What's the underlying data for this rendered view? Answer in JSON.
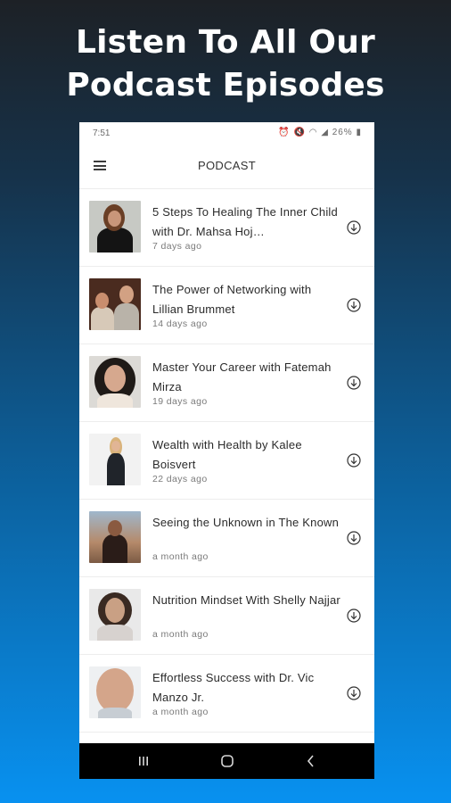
{
  "promo": {
    "line1": "Listen To All Our",
    "line2": "Podcast Episodes"
  },
  "status_bar": {
    "time": "7:51",
    "battery": "26%"
  },
  "app_bar": {
    "title": "PODCAST",
    "menu_icon": "hamburger-menu-icon"
  },
  "episodes": [
    {
      "title": "5 Steps To Healing The Inner Child with Dr. Mahsa Hoj…",
      "date": "7 days ago"
    },
    {
      "title": "The Power of Networking with Lillian Brummet",
      "date": "14 days ago"
    },
    {
      "title": "Master Your Career with Fatemah Mirza",
      "date": "19 days ago"
    },
    {
      "title": "Wealth with Health by Kalee Boisvert",
      "date": "22 days ago"
    },
    {
      "title": "Seeing the Unknown in The Known",
      "date": "a month ago"
    },
    {
      "title": "Nutrition Mindset With Shelly Najjar",
      "date": "a month ago"
    },
    {
      "title": "Effortless Success with Dr. Vic Manzo Jr.",
      "date": "a month ago"
    }
  ],
  "icons": {
    "download": "download-circle-icon",
    "nav_recent": "recent-apps-icon",
    "nav_home": "home-icon",
    "nav_back": "back-icon"
  },
  "colors": {
    "gradient_top": "#1d2126",
    "gradient_bottom": "#0891f0",
    "headline": "#ffffff"
  }
}
